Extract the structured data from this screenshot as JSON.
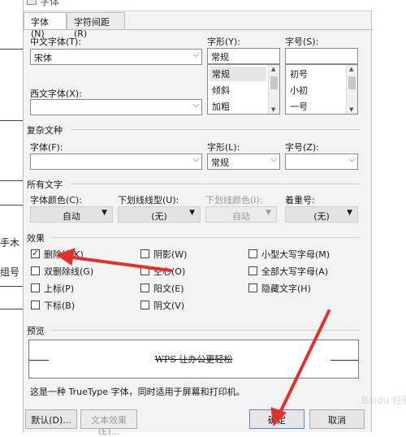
{
  "background_doc": {
    "fragments": [
      "手木",
      "组号"
    ]
  },
  "titlebar": {
    "title": "字体"
  },
  "tabs": [
    {
      "label": "字体(N)",
      "active": true
    },
    {
      "label": "字符间距(R)",
      "active": false
    }
  ],
  "font": {
    "chinese_label": "中文字体(T):",
    "chinese_value": "宋体",
    "western_label": "西文字体(X):",
    "western_value": "",
    "style_label": "字形(Y):",
    "style_value": "常规",
    "style_options": [
      "常规",
      "倾斜",
      "加粗"
    ],
    "size_label": "字号(S):",
    "size_value": "",
    "size_options": [
      "初号",
      "小初",
      "一号"
    ]
  },
  "complex": {
    "section_title": "复杂文种",
    "font_label": "字体(F):",
    "font_value": "",
    "style_label": "字形(L):",
    "style_value": "常规",
    "size_label": "字号(Z):",
    "size_value": ""
  },
  "all_text": {
    "section_title": "所有文字",
    "color_label": "字体颜色(C):",
    "color_value": "自动",
    "underline_label": "下划线线型(U):",
    "underline_value": "(无)",
    "underline_color_label": "下划线颜色(I):",
    "underline_color_value": "自动",
    "emphasis_label": "着重号:",
    "emphasis_value": "(无)"
  },
  "effects": {
    "section_title": "效果",
    "items": [
      {
        "label": "删除线(K)",
        "checked": true
      },
      {
        "label": "双删除线(G)",
        "checked": false
      },
      {
        "label": "上标(P)",
        "checked": false
      },
      {
        "label": "下标(B)",
        "checked": false
      },
      {
        "label": "阴影(W)",
        "checked": false
      },
      {
        "label": "空心(O)",
        "checked": false
      },
      {
        "label": "阳文(E)",
        "checked": false
      },
      {
        "label": "阴文(V)",
        "checked": false
      },
      {
        "label": "小型大写字母(M)",
        "checked": false
      },
      {
        "label": "全部大写字母(A)",
        "checked": false
      },
      {
        "label": "隐藏文字(H)",
        "checked": false
      }
    ]
  },
  "preview": {
    "section_title": "预览",
    "sample": "WPS 让办公更轻松",
    "note": "这是一种 TrueType 字体，同时适用于屏幕和打印机。"
  },
  "buttons": {
    "default": "默认(D)...",
    "text_effect": "文本效果(E)...",
    "ok": "确定",
    "cancel": "取消"
  },
  "watermark": "Baidu 经验",
  "colors": {
    "annotation_arrow": "#e0322a",
    "primary_border": "#5a87c8"
  }
}
